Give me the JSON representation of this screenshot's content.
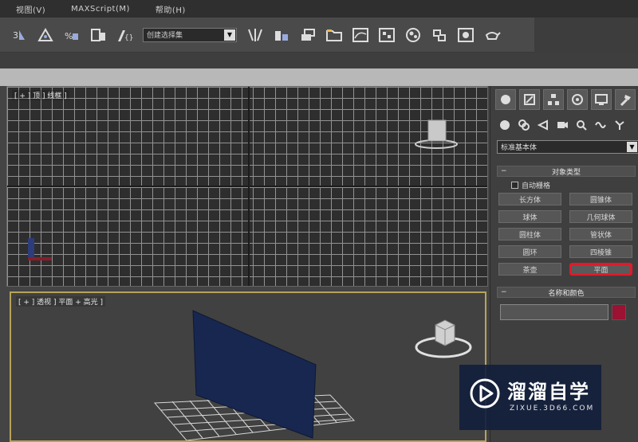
{
  "menubar": {
    "items": [
      "视图(V)",
      "MAXScript(M)",
      "帮助(H)"
    ]
  },
  "toolbar": {
    "selection_set": "创建选择集"
  },
  "viewports": {
    "top_label": "[ + ] 顶 ] 线框 ]",
    "persp_label": "[ + ] 透视 ] 平面 + 高光 ]"
  },
  "command_panel": {
    "category_select": "标准基本体",
    "object_type_title": "对象类型",
    "autogrid_label": "自动栅格",
    "object_buttons": [
      "长方体",
      "圆锥体",
      "球体",
      "几何球体",
      "圆柱体",
      "管状体",
      "圆环",
      "四棱锥",
      "茶壶",
      "平面"
    ],
    "active_button": "平面",
    "name_color_title": "名称和颜色",
    "object_color": "#9b1232"
  },
  "watermark": {
    "title": "溜溜自学",
    "url": "ZIXUE.3D66.COM"
  }
}
